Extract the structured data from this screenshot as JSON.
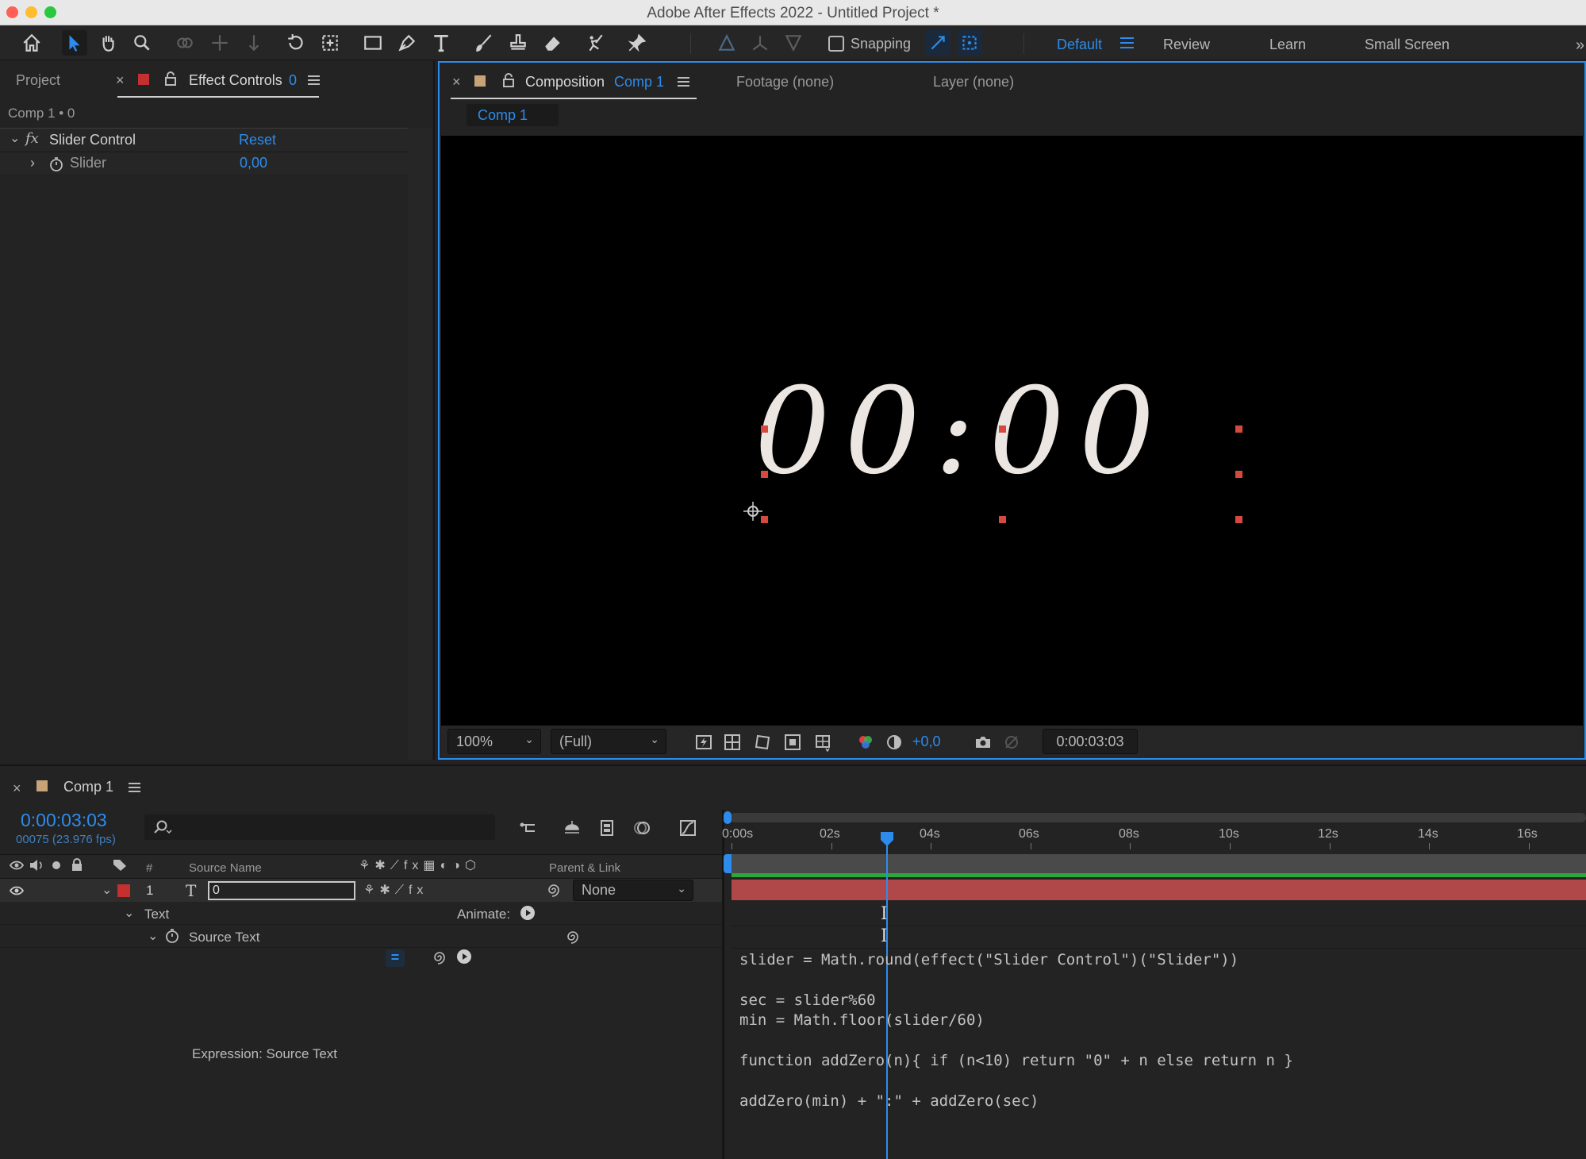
{
  "window": {
    "title": "Adobe After Effects 2022 - Untitled Project *"
  },
  "toolbar": {
    "tools": [
      "home-icon",
      "selection-tool-icon",
      "hand-tool-icon",
      "zoom-tool-icon",
      "orbit-camera-icon",
      "pan-camera-icon",
      "dolly-camera-icon",
      "rotation-tool-icon",
      "pan-behind-icon",
      "rectangle-tool-icon",
      "pen-tool-icon",
      "type-tool-icon",
      "brush-tool-icon",
      "clone-stamp-icon",
      "eraser-icon",
      "roto-brush-icon",
      "puppet-pin-icon"
    ],
    "snapping_label": "Snapping",
    "workspaces": [
      "Default",
      "Review",
      "Learn",
      "Small Screen"
    ]
  },
  "left_panel": {
    "tab_project": "Project",
    "tab_effect_controls": "Effect Controls",
    "tab_effect_controls_layer": "0",
    "subtitle": "Comp 1 • 0",
    "effect_name": "Slider Control",
    "reset_label": "Reset",
    "param_name": "Slider",
    "param_value": "0,00"
  },
  "viewer": {
    "tab_composition": "Composition",
    "tab_composition_name": "Comp 1",
    "tab_footage": "Footage (none)",
    "tab_layer": "Layer (none)",
    "comp_chip": "Comp 1",
    "display_text": "00:00",
    "zoom": "100%",
    "resolution": "(Full)",
    "exposure": "+0,0",
    "timecode": "0:00:03:03"
  },
  "timeline": {
    "tab": "Comp 1",
    "timecode": "0:00:03:03",
    "frame_info": "00075 (23.976 fps)",
    "col_source_name": "Source Name",
    "col_parent": "Parent & Link",
    "col_num": "#",
    "layer_index": "1",
    "layer_name": "0",
    "layer_parent": "None",
    "prop_text": "Text",
    "animate_label": "Animate:",
    "prop_source_text": "Source Text",
    "expression_label": "Expression: Source Text",
    "ruler": [
      "0:00s",
      "02s",
      "04s",
      "06s",
      "08s",
      "10s",
      "12s",
      "14s",
      "16s"
    ],
    "code": [
      "slider = Math.round(effect(\"Slider Control\")(\"Slider\"))",
      "",
      "sec = slider%60",
      "min = Math.floor(slider/60)",
      "",
      "function addZero(n){ if (n<10) return \"0\" + n else return n }",
      "",
      "addZero(min) + \":\" + addZero(sec)"
    ]
  },
  "colors": {
    "accent": "#2d8ceb",
    "label_red": "#c3302f",
    "layer_bar": "#b0484a",
    "work_area": "#2ca83a"
  }
}
